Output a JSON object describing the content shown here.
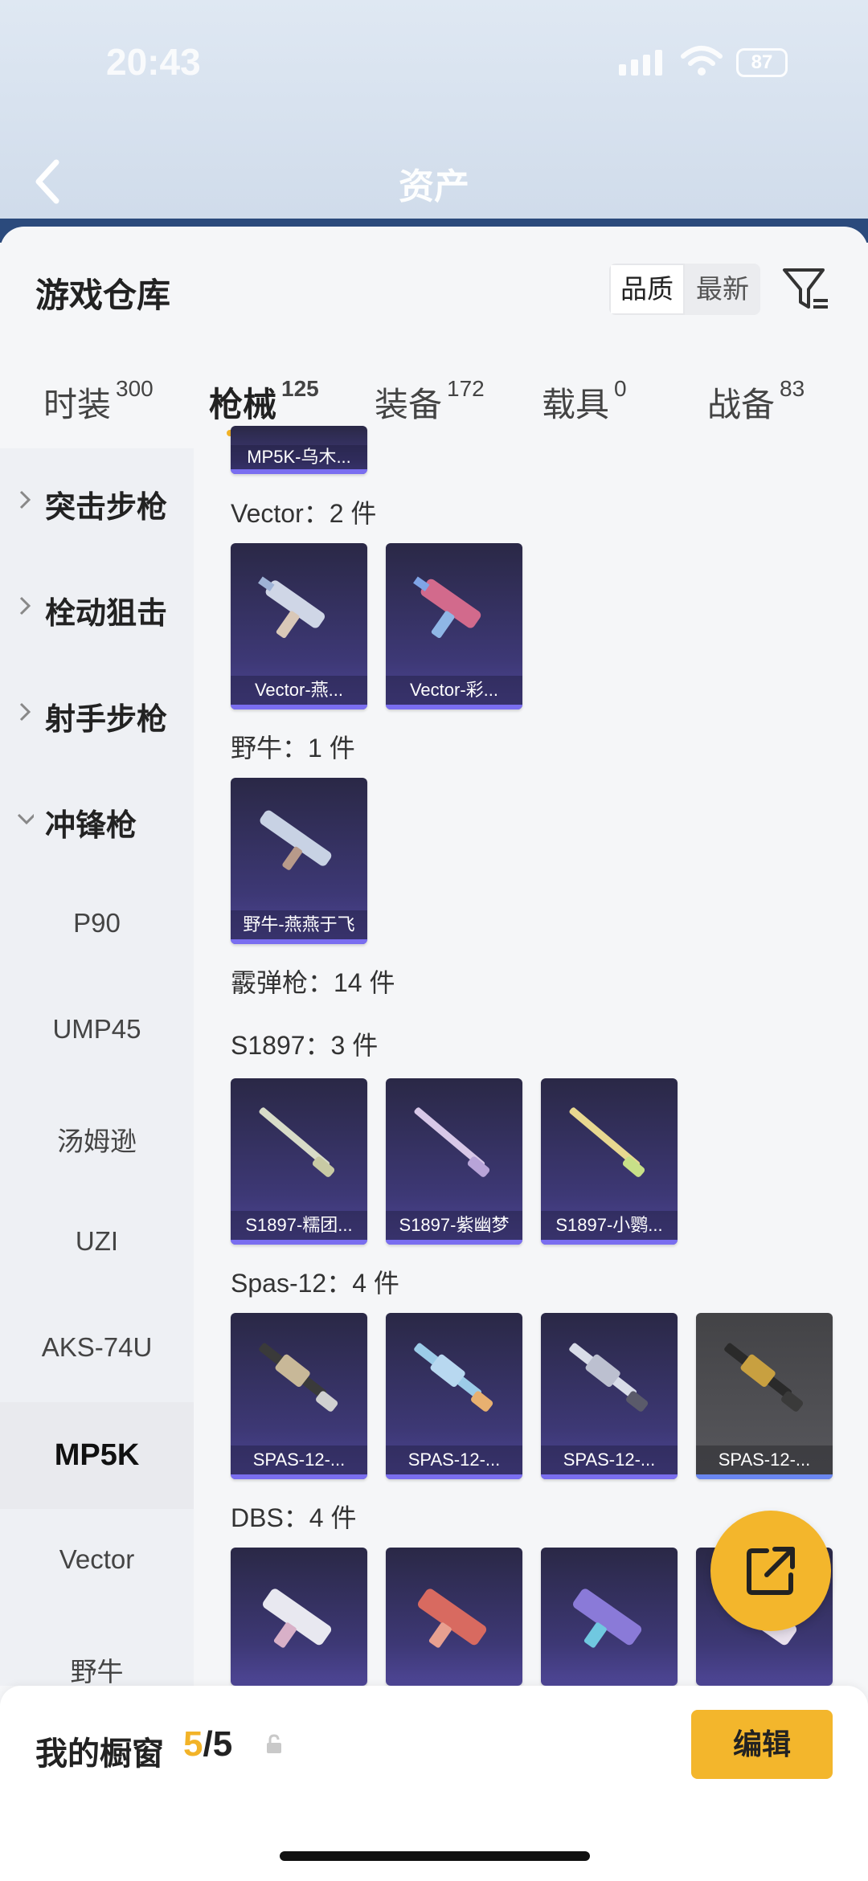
{
  "status": {
    "time": "20:43",
    "battery": "87"
  },
  "nav": {
    "tabs": [
      "",
      "",
      "资产",
      ""
    ],
    "active_tab": "资产"
  },
  "header": {
    "title": "游戏仓库",
    "sort_options": [
      "品质",
      "最新"
    ],
    "selected_sort": "品质"
  },
  "tabs": [
    {
      "label": "时装",
      "count": "300"
    },
    {
      "label": "枪械",
      "count": "125"
    },
    {
      "label": "装备",
      "count": "172"
    },
    {
      "label": "载具",
      "count": "0"
    },
    {
      "label": "战备",
      "count": "83"
    }
  ],
  "active_tab": "枪械",
  "sidebar": {
    "categories": [
      "突击步枪",
      "栓动狙击",
      "射手步枪",
      "冲锋枪"
    ],
    "subitems": [
      "P90",
      "UMP45",
      "汤姆逊",
      "UZI",
      "AKS-74U",
      "MP5K",
      "Vector",
      "野牛"
    ],
    "selected": "MP5K"
  },
  "content": {
    "partial_top_caption": "MP5K-乌木...",
    "groups": [
      {
        "title": "Vector：2 件",
        "items": [
          "Vector-燕...",
          "Vector-彩..."
        ]
      },
      {
        "title": "野牛：1 件",
        "items": [
          "野牛-燕燕于飞"
        ]
      },
      {
        "title": "霰弹枪：14 件",
        "items": []
      },
      {
        "title": "S1897：3 件",
        "items": [
          "S1897-糯团...",
          "S1897-紫幽梦",
          "S1897-小鹦..."
        ]
      },
      {
        "title": "Spas-12：4 件",
        "items": [
          "SPAS-12-...",
          "SPAS-12-...",
          "SPAS-12-...",
          "SPAS-12-..."
        ]
      },
      {
        "title": "DBS：4 件",
        "items": []
      }
    ]
  },
  "footer": {
    "window_label": "我的橱窗",
    "window_current": "5",
    "window_total": "/5",
    "edit_label": "编辑"
  },
  "colors": {
    "accent": "#f2b328",
    "card_top": "#2a2846",
    "card_bottom": "#4e4696"
  },
  "icons": {
    "back": "chevron-left-icon",
    "filter": "filter-icon",
    "share": "share-external-icon",
    "lock": "lock-icon"
  }
}
